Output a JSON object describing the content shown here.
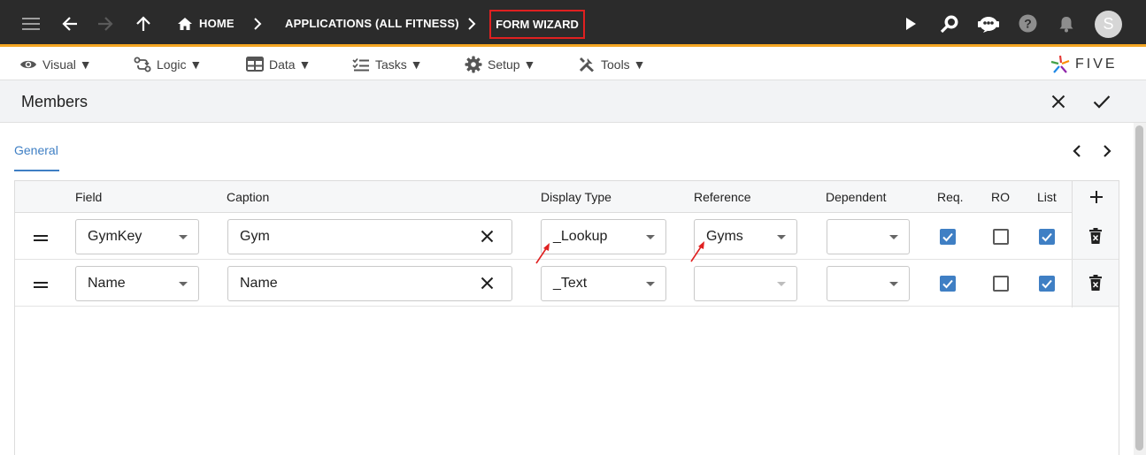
{
  "topbar": {
    "breadcrumb": {
      "home": "HOME",
      "applications": "APPLICATIONS (ALL FITNESS)",
      "current": "FORM WIZARD"
    },
    "avatar_initial": "S",
    "bar_color": "#2b2b2b",
    "accent_color": "#f5a623",
    "highlight_color": "#e02020"
  },
  "menubar": {
    "items": [
      {
        "label": "Visual ▼",
        "icon": "eye-icon"
      },
      {
        "label": "Logic ▼",
        "icon": "logic-icon"
      },
      {
        "label": "Data ▼",
        "icon": "table-icon"
      },
      {
        "label": "Tasks ▼",
        "icon": "tasks-icon"
      },
      {
        "label": "Setup ▼",
        "icon": "gear-icon"
      },
      {
        "label": "Tools ▼",
        "icon": "tools-icon"
      }
    ],
    "logo_text": "FIVE"
  },
  "form": {
    "title": "Members"
  },
  "tabs": [
    {
      "label": "General",
      "active": true
    }
  ],
  "table": {
    "headers": {
      "field": "Field",
      "caption": "Caption",
      "display_type": "Display Type",
      "reference": "Reference",
      "dependent": "Dependent",
      "req": "Req.",
      "ro": "RO",
      "list": "List"
    },
    "rows": [
      {
        "field": "GymKey",
        "caption": "Gym",
        "display_type": "_Lookup",
        "reference": "Gyms",
        "dependent": "",
        "req": true,
        "ro": false,
        "list": true
      },
      {
        "field": "Name",
        "caption": "Name",
        "display_type": "_Text",
        "reference": "",
        "dependent": "",
        "req": true,
        "ro": false,
        "list": true
      }
    ]
  },
  "accent_color": "#3f7fc4"
}
